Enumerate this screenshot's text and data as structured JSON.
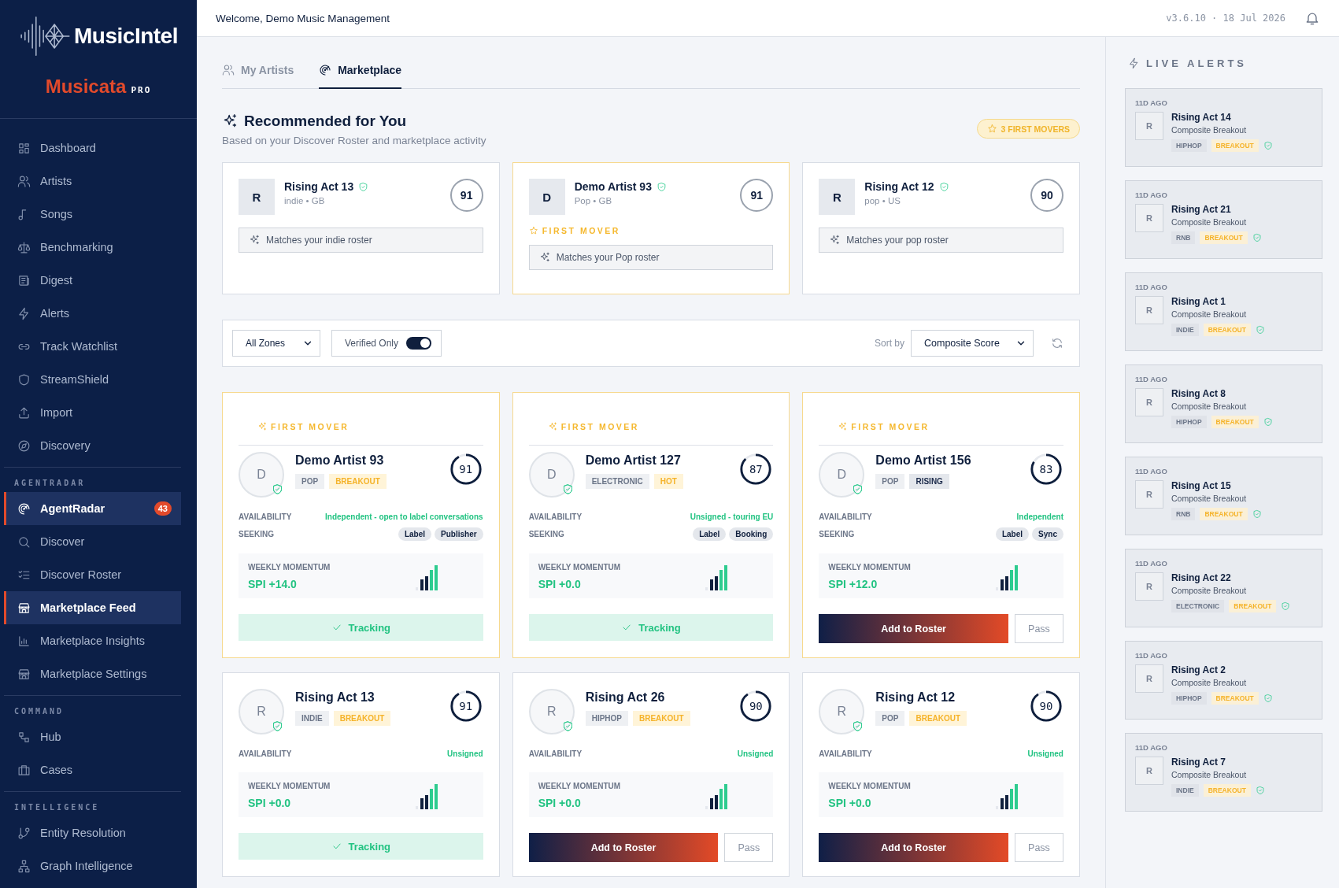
{
  "header": {
    "welcome": "Welcome, Demo Music Management",
    "version": "v3.6.10 · 18 Jul 2026"
  },
  "brand": {
    "name": "MusicIntel",
    "product": "Musicata",
    "tier": "PRO"
  },
  "sidebar": {
    "sections": [
      {
        "items": [
          {
            "label": "Dashboard",
            "selected": false
          },
          {
            "label": "Artists",
            "selected": false
          },
          {
            "label": "Songs",
            "selected": false
          },
          {
            "label": "Benchmarking",
            "selected": false
          },
          {
            "label": "Digest",
            "selected": false
          },
          {
            "label": "Alerts",
            "selected": false
          },
          {
            "label": "Track Watchlist",
            "selected": false
          },
          {
            "label": "StreamShield",
            "selected": false
          },
          {
            "label": "Import",
            "selected": false
          },
          {
            "label": "Discovery",
            "selected": false
          }
        ]
      },
      {
        "heading": "AGENTRADAR",
        "items": [
          {
            "label": "AgentRadar",
            "selected": true,
            "badge": "43"
          },
          {
            "label": "Discover",
            "selected": false
          },
          {
            "label": "Discover Roster",
            "selected": false
          },
          {
            "label": "Marketplace Feed",
            "selected": true
          },
          {
            "label": "Marketplace Insights",
            "selected": false
          },
          {
            "label": "Marketplace Settings",
            "selected": false
          }
        ]
      },
      {
        "heading": "COMMAND",
        "items": [
          {
            "label": "Hub",
            "selected": false
          },
          {
            "label": "Cases",
            "selected": false
          }
        ]
      },
      {
        "heading": "INTELLIGENCE",
        "items": [
          {
            "label": "Entity Resolution",
            "selected": false
          },
          {
            "label": "Graph Intelligence",
            "selected": false
          }
        ]
      }
    ]
  },
  "tabs": [
    {
      "label": "My Artists",
      "selected": false
    },
    {
      "label": "Marketplace",
      "selected": true
    }
  ],
  "recommended": {
    "title": "Recommended for You",
    "subtitle": "Based on your Discover Roster and marketplace activity",
    "badge": "3 FIRST MOVERS",
    "cards": [
      {
        "initial": "R",
        "name": "Rising Act 13",
        "verified": true,
        "meta": "indie • GB",
        "score": "91",
        "reason": "Matches your indie roster"
      },
      {
        "initial": "D",
        "name": "Demo Artist 93",
        "verified": true,
        "meta": "Pop • GB",
        "score": "91",
        "first_mover": "FIRST MOVER",
        "reason": "Matches your Pop roster"
      },
      {
        "initial": "R",
        "name": "Rising Act 12",
        "verified": true,
        "meta": "pop • US",
        "score": "90",
        "reason": "Matches your pop roster"
      }
    ]
  },
  "filters": {
    "zone": "All Zones",
    "verified": {
      "label": "Verified Only",
      "on": true
    },
    "sort_label": "Sort by",
    "sort": "Composite Score"
  },
  "feed": [
    {
      "first_mover": "FIRST MOVER",
      "initial": "D",
      "verified": true,
      "name": "Demo Artist 93",
      "genre": "POP",
      "status": {
        "label": "BREAKOUT",
        "kind": "breakout"
      },
      "score": "91",
      "level": 0.91,
      "availability_label": "AVAILABILITY",
      "availability": "Independent - open to label conversations",
      "seeking_label": "SEEKING",
      "seeking": [
        "Label",
        "Publisher"
      ],
      "momentum_label": "WEEKLY MOMENTUM",
      "spi": "SPI +14.0",
      "action": {
        "kind": "tracking",
        "label": "Tracking"
      }
    },
    {
      "first_mover": "FIRST MOVER",
      "initial": "D",
      "verified": true,
      "name": "Demo Artist 127",
      "genre": "ELECTRONIC",
      "status": {
        "label": "HOT",
        "kind": "hot"
      },
      "score": "87",
      "level": 0.87,
      "availability_label": "AVAILABILITY",
      "availability": "Unsigned - touring EU",
      "seeking_label": "SEEKING",
      "seeking": [
        "Label",
        "Booking"
      ],
      "momentum_label": "WEEKLY MOMENTUM",
      "spi": "SPI +0.0",
      "action": {
        "kind": "tracking",
        "label": "Tracking"
      }
    },
    {
      "first_mover": "FIRST MOVER",
      "initial": "D",
      "verified": true,
      "name": "Demo Artist 156",
      "genre": "POP",
      "status": {
        "label": "RISING",
        "kind": "rising"
      },
      "score": "83",
      "level": 0.83,
      "availability_label": "AVAILABILITY",
      "availability": "Independent",
      "seeking_label": "SEEKING",
      "seeking": [
        "Label",
        "Sync"
      ],
      "momentum_label": "WEEKLY MOMENTUM",
      "spi": "SPI +12.0",
      "action": {
        "kind": "add",
        "label": "Add to Roster",
        "pass": "Pass"
      }
    },
    {
      "initial": "R",
      "verified": true,
      "name": "Rising Act 13",
      "genre": "INDIE",
      "status": {
        "label": "BREAKOUT",
        "kind": "breakout"
      },
      "score": "91",
      "level": 0.91,
      "availability_label": "AVAILABILITY",
      "availability": "Unsigned",
      "momentum_label": "WEEKLY MOMENTUM",
      "spi": "SPI +0.0",
      "action": {
        "kind": "tracking",
        "label": "Tracking"
      }
    },
    {
      "initial": "R",
      "verified": true,
      "name": "Rising Act 26",
      "genre": "HIPHOP",
      "status": {
        "label": "BREAKOUT",
        "kind": "breakout"
      },
      "score": "90",
      "level": 0.9,
      "availability_label": "AVAILABILITY",
      "availability": "Unsigned",
      "momentum_label": "WEEKLY MOMENTUM",
      "spi": "SPI +0.0",
      "action": {
        "kind": "add",
        "label": "Add to Roster",
        "pass": "Pass"
      }
    },
    {
      "initial": "R",
      "verified": true,
      "name": "Rising Act 12",
      "genre": "POP",
      "status": {
        "label": "BREAKOUT",
        "kind": "breakout"
      },
      "score": "90",
      "level": 0.9,
      "availability_label": "AVAILABILITY",
      "availability": "Unsigned",
      "momentum_label": "WEEKLY MOMENTUM",
      "spi": "SPI +0.0",
      "action": {
        "kind": "add",
        "label": "Add to Roster",
        "pass": "Pass"
      }
    }
  ],
  "alerts": {
    "title": "LIVE ALERTS",
    "items": [
      {
        "time": "11D AGO",
        "initial": "R",
        "name": "Rising Act 14",
        "subtitle": "Composite Breakout",
        "genre": "HIPHOP",
        "status": "BREAKOUT",
        "verified": true
      },
      {
        "time": "11D AGO",
        "initial": "R",
        "name": "Rising Act 21",
        "subtitle": "Composite Breakout",
        "genre": "RNB",
        "status": "BREAKOUT",
        "verified": true
      },
      {
        "time": "11D AGO",
        "initial": "R",
        "name": "Rising Act 1",
        "subtitle": "Composite Breakout",
        "genre": "INDIE",
        "status": "BREAKOUT",
        "verified": true
      },
      {
        "time": "11D AGO",
        "initial": "R",
        "name": "Rising Act 8",
        "subtitle": "Composite Breakout",
        "genre": "HIPHOP",
        "status": "BREAKOUT",
        "verified": true
      },
      {
        "time": "11D AGO",
        "initial": "R",
        "name": "Rising Act 15",
        "subtitle": "Composite Breakout",
        "genre": "RNB",
        "status": "BREAKOUT",
        "verified": true
      },
      {
        "time": "11D AGO",
        "initial": "R",
        "name": "Rising Act 22",
        "subtitle": "Composite Breakout",
        "genre": "ELECTRONIC",
        "status": "BREAKOUT",
        "verified": true
      },
      {
        "time": "11D AGO",
        "initial": "R",
        "name": "Rising Act 2",
        "subtitle": "Composite Breakout",
        "genre": "HIPHOP",
        "status": "BREAKOUT",
        "verified": true
      },
      {
        "time": "11D AGO",
        "initial": "R",
        "name": "Rising Act 7",
        "subtitle": "Composite Breakout",
        "genre": "INDIE",
        "status": "BREAKOUT",
        "verified": true
      }
    ]
  }
}
